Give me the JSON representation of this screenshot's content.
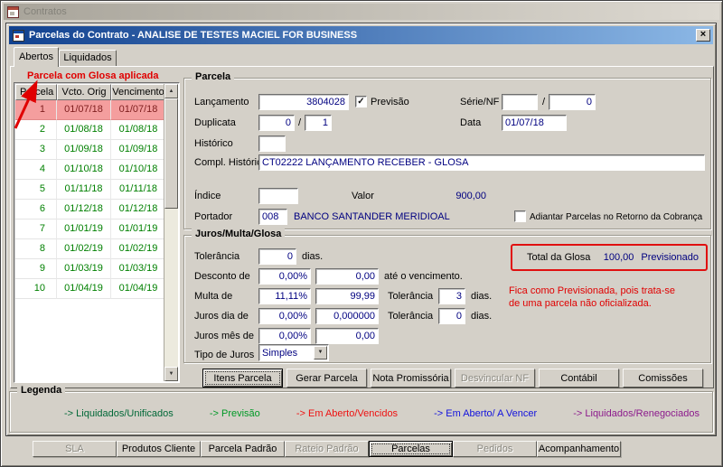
{
  "colors": {
    "selected_row_bg": "#f49e9e",
    "selected_row_text": "#7e1e1e",
    "grid_date_text": "#008000",
    "input_text": "#000080",
    "annotation_red": "#e00000",
    "titlebar_active_from": "#11418f",
    "titlebar_active_to": "#8cb8e6"
  },
  "icons": {
    "close": "×",
    "check": "✓",
    "dropdown_arrow": "▼",
    "scroll_up": "▲",
    "scroll_down": "▼"
  },
  "window": {
    "title": "Contratos"
  },
  "dialog": {
    "title": "Parcelas do Contrato - ANALISE DE TESTES MACIEL FOR BUSINESS"
  },
  "tabs": [
    {
      "label": "Abertos",
      "active": true
    },
    {
      "label": "Liquidados",
      "active": false
    }
  ],
  "annotations": {
    "glosa_applied": "Parcela com Glosa aplicada",
    "previsionada_line1": "Fica como Previsionada, pois trata-se",
    "previsionada_line2": "de uma parcela não oficializada."
  },
  "grid": {
    "headers": [
      "Parcela",
      "Vcto. Orig",
      "Vencimento"
    ],
    "rows": [
      {
        "parcela": "1",
        "vcto": "01/07/18",
        "venc": "01/07/18",
        "selected": true
      },
      {
        "parcela": "2",
        "vcto": "01/08/18",
        "venc": "01/08/18",
        "selected": false
      },
      {
        "parcela": "3",
        "vcto": "01/09/18",
        "venc": "01/09/18",
        "selected": false
      },
      {
        "parcela": "4",
        "vcto": "01/10/18",
        "venc": "01/10/18",
        "selected": false
      },
      {
        "parcela": "5",
        "vcto": "01/11/18",
        "venc": "01/11/18",
        "selected": false
      },
      {
        "parcela": "6",
        "vcto": "01/12/18",
        "venc": "01/12/18",
        "selected": false
      },
      {
        "parcela": "7",
        "vcto": "01/01/19",
        "venc": "01/01/19",
        "selected": false
      },
      {
        "parcela": "8",
        "vcto": "01/02/19",
        "venc": "01/02/19",
        "selected": false
      },
      {
        "parcela": "9",
        "vcto": "01/03/19",
        "venc": "01/03/19",
        "selected": false
      },
      {
        "parcela": "10",
        "vcto": "01/04/19",
        "venc": "01/04/19",
        "selected": false
      }
    ]
  },
  "parcela": {
    "group_title": "Parcela",
    "lancamento_label": "Lançamento",
    "lancamento_value": "3804028",
    "previsao_label": "Previsão",
    "previsao_checked": true,
    "serie_nf_label": "Série/NF",
    "serie_nf_value1": "",
    "slash": "/",
    "serie_nf_value2": "0",
    "duplicata_label": "Duplicata",
    "duplicata_value1": "0",
    "duplicata_value2": "1",
    "data_label": "Data",
    "data_value": "01/07/18",
    "historico_label": "Histórico",
    "historico_value": "",
    "compl_historico_label": "Compl. Histórico",
    "compl_historico_value": "CT02222 LANÇAMENTO RECEBER - GLOSA",
    "indice_label": "Índice",
    "indice_value": "",
    "valor_label": "Valor",
    "valor_value": "900,00",
    "portador_label": "Portador",
    "portador_code": "008",
    "portador_name": "BANCO SANTANDER MERIDIOAL",
    "adiantar_label": "Adiantar Parcelas no Retorno da Cobrança",
    "adiantar_checked": false
  },
  "juros": {
    "group_title": "Juros/Multa/Glosa",
    "tolerancia_label": "Tolerância",
    "tolerancia_value": "0",
    "dias_label": "dias.",
    "desconto_label": "Desconto de",
    "desconto_pct": "0,00%",
    "desconto_value": "0,00",
    "ate_vencimento_label": "até o vencimento.",
    "multa_label": "Multa de",
    "multa_pct": "11,11%",
    "multa_value": "99,99",
    "tolerancia2_label": "Tolerância",
    "tolerancia2_value": "3",
    "dias2_label": "dias.",
    "juros_dia_label": "Juros dia de",
    "juros_dia_pct": "0,00%",
    "juros_dia_value": "0,000000",
    "tolerancia3_label": "Tolerância",
    "tolerancia3_value": "0",
    "dias3_label": "dias.",
    "juros_mes_label": "Juros mês de",
    "juros_mes_pct": "0,00%",
    "juros_mes_value": "0,00",
    "tipo_juros_label": "Tipo de Juros",
    "tipo_juros_value": "Simples"
  },
  "glosa_box": {
    "label": "Total da Glosa",
    "value": "100,00",
    "status": "Previsionado"
  },
  "action_buttons": [
    {
      "label": "Itens Parcela",
      "enabled": true,
      "default": true
    },
    {
      "label": "Gerar Parcela",
      "enabled": true
    },
    {
      "label": "Nota Promissória",
      "enabled": true
    },
    {
      "label": "Desvincular NF",
      "enabled": false
    },
    {
      "label": "Contábil",
      "enabled": true
    },
    {
      "label": "Comissões",
      "enabled": true
    }
  ],
  "legend": {
    "title": "Legenda",
    "items": [
      {
        "label": "-> Liquidados/Unificados",
        "color": "#006837"
      },
      {
        "label": "-> Previsão",
        "color": "#009926"
      },
      {
        "label": "-> Em Aberto/Vencidos",
        "color": "#ee1111"
      },
      {
        "label": "-> Em Aberto/ A Vencer",
        "color": "#1111dd"
      },
      {
        "label": "-> Liquidados/Renegociados",
        "color": "#8c1a8c"
      }
    ]
  },
  "bottom_buttons": [
    {
      "label": "SLA",
      "enabled": false
    },
    {
      "label": "Produtos Cliente",
      "enabled": true
    },
    {
      "label": "Parcela Padrão",
      "enabled": true
    },
    {
      "label": "Rateio Padrão",
      "enabled": false
    },
    {
      "label": "Parcelas",
      "enabled": true,
      "active": true
    },
    {
      "label": "Pedidos",
      "enabled": false
    },
    {
      "label": "Acompanhamento",
      "enabled": true
    }
  ]
}
